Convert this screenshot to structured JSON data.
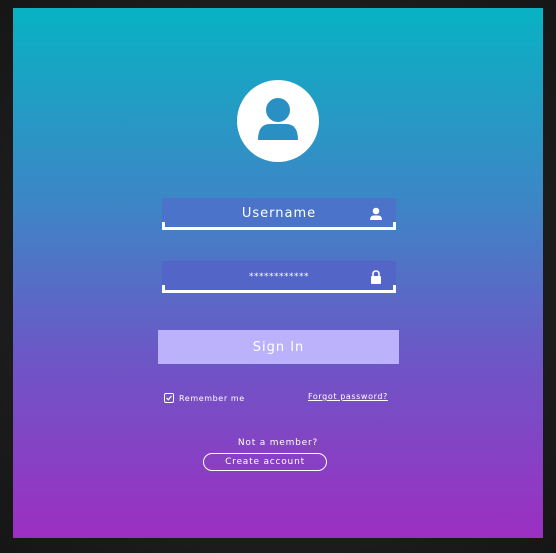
{
  "login": {
    "username_placeholder": "Username",
    "password_value": "************",
    "sign_in_label": "Sign In",
    "remember_label": "Remember me",
    "remember_checked": true,
    "forgot_label": "Forgot password?",
    "not_member_text": "Not a member?",
    "create_account_label": "Create account"
  },
  "icons": {
    "avatar": "user-avatar-icon",
    "username": "user-icon",
    "password": "lock-icon",
    "checkbox": "checkmark-icon"
  },
  "colors": {
    "gradient_top": "#08b2c3",
    "gradient_bottom": "#9c2fc2",
    "sign_in_button": "#bcb1fb",
    "field_background": "#4b73c9",
    "text": "#ffffff"
  }
}
